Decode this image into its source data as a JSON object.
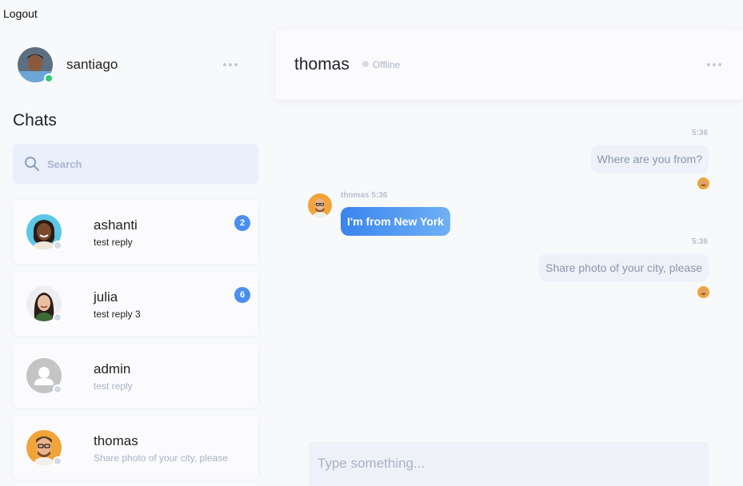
{
  "nav": {
    "logout_label": "Logout"
  },
  "current_user": {
    "name": "santiago",
    "status": "online",
    "status_color": "#2ecc71"
  },
  "sidebar": {
    "title": "Chats",
    "search_placeholder": "Search",
    "chats": [
      {
        "name": "ashanti",
        "last_message": "test reply",
        "unread": "2"
      },
      {
        "name": "julia",
        "last_message": "test reply 3",
        "unread": "6"
      },
      {
        "name": "admin",
        "last_message": "test reply"
      },
      {
        "name": "thomas",
        "last_message": "Share photo of your city, please"
      }
    ]
  },
  "conversation": {
    "contact_name": "thomas",
    "presence": "Offline",
    "messages": [
      {
        "direction": "out",
        "time": "5:36",
        "text": "Where are you from?"
      },
      {
        "direction": "in",
        "sender": "thomas",
        "time": "5:36",
        "text": "I'm from New York"
      },
      {
        "direction": "out",
        "time": "5:36",
        "text": "Share photo of your city, please"
      }
    ],
    "composer_placeholder": "Type something..."
  },
  "colors": {
    "accent": "#4a8ff0",
    "badge": "#4a8ff0",
    "offline_dot": "#d4dae5"
  }
}
